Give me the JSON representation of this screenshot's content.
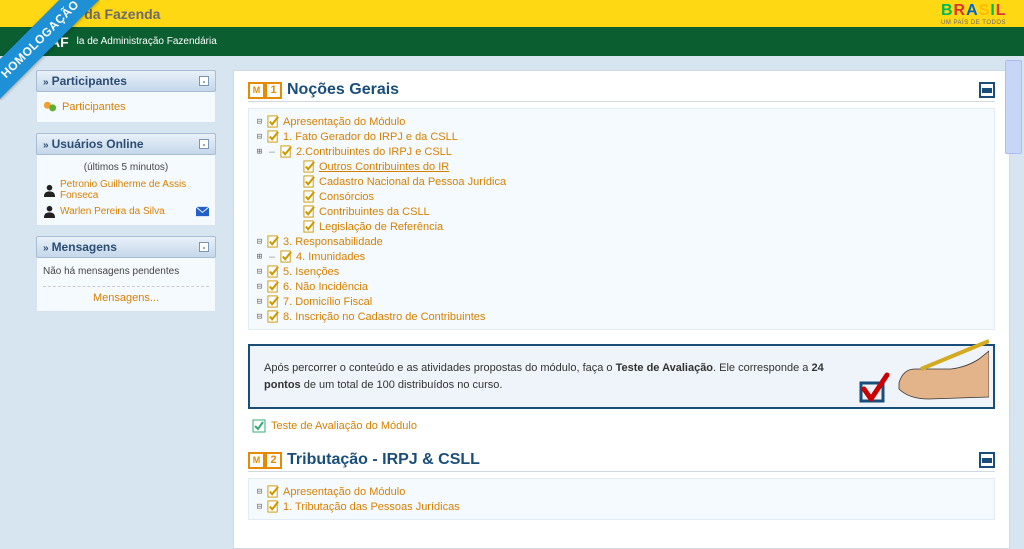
{
  "ribbon": "HOMOLOGAÇÃO",
  "topbar": {
    "title": "tério da Fazenda",
    "logo_sub": "UM PAÍS DE TODOS"
  },
  "greenbar": {
    "af": "AF",
    "sub": "la de Administração Fazendária"
  },
  "sidebar": {
    "participants": {
      "title": "Participantes",
      "link": "Participantes"
    },
    "online": {
      "title": "Usuários Online",
      "sub": "(últimos 5 minutos)",
      "users": [
        {
          "name": "Petronio Guilherme de Assis Fonseca"
        },
        {
          "name": "Warlen Pereira da Silva",
          "mail": true
        }
      ]
    },
    "messages": {
      "title": "Mensagens",
      "none": "Não há mensagens pendentes",
      "link": "Mensagens..."
    }
  },
  "module1": {
    "title": "Noções Gerais",
    "items": [
      {
        "label": "Apresentação do Módulo",
        "indent": 0,
        "toggle": "-"
      },
      {
        "label": "1. Fato Gerador do IRPJ e da CSLL",
        "indent": 0,
        "toggle": "-"
      },
      {
        "label": "2.Contribuintes do IRPJ e CSLL",
        "indent": 0,
        "toggle": "+-"
      },
      {
        "label": "Outros Contribuintes do IR",
        "indent": 1,
        "toggle": "",
        "underline": true
      },
      {
        "label": "Cadastro Nacional da Pessoa Jurídica",
        "indent": 1,
        "toggle": ""
      },
      {
        "label": "Consórcios",
        "indent": 1,
        "toggle": ""
      },
      {
        "label": "Contribuintes da CSLL",
        "indent": 1,
        "toggle": ""
      },
      {
        "label": "Legislação de Referência",
        "indent": 1,
        "toggle": ""
      },
      {
        "label": "3. Responsabilidade",
        "indent": 0,
        "toggle": "-"
      },
      {
        "label": "4. Imunidades",
        "indent": 0,
        "toggle": "+-"
      },
      {
        "label": "5. Isenções",
        "indent": 0,
        "toggle": "-"
      },
      {
        "label": "6. Não Incidência",
        "indent": 0,
        "toggle": "-"
      },
      {
        "label": "7. Domicílio Fiscal",
        "indent": 0,
        "toggle": "-"
      },
      {
        "label": "8. Inscrição no Cadastro de Contribuintes",
        "indent": 0,
        "toggle": "-"
      }
    ],
    "info_pre": "Após percorrer o conteúdo e as atividades propostas do módulo, faça o ",
    "info_bold1": "Teste de Avaliação",
    "info_mid": ". Ele corresponde a ",
    "info_bold2": "24 pontos",
    "info_post": " de um total de 100 distribuídos no curso.",
    "test_link": "Teste de Avaliação do Módulo"
  },
  "module2": {
    "title": "Tributação - IRPJ & CSLL",
    "items": [
      {
        "label": "Apresentação do Módulo",
        "toggle": "-"
      },
      {
        "label": "1. Tributação das Pessoas Jurídicas",
        "toggle": "-"
      }
    ]
  }
}
